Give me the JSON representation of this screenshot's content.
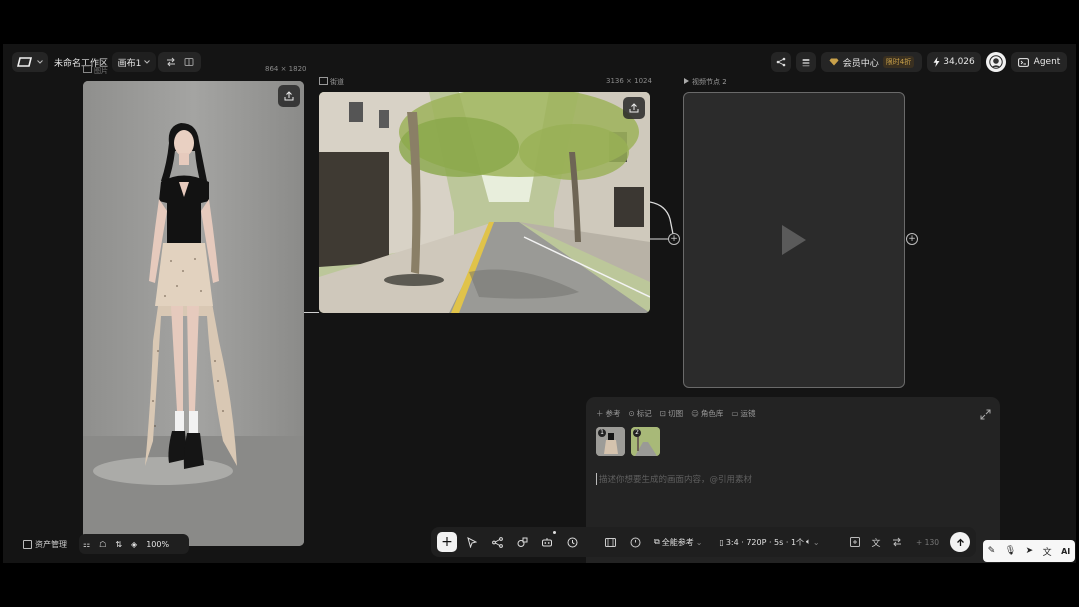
{
  "header": {
    "workspace_name": "未命名工作区",
    "canvas_label": "画布1",
    "member_center_label": "会员中心",
    "member_badge": "限时4折",
    "credits": "34,026",
    "agent_label": "Agent"
  },
  "canvas": {
    "node1": {
      "size_label": "864 × 1820",
      "title": "图片"
    },
    "node2": {
      "title": "街道",
      "size_label": "3136 × 1024"
    },
    "node3": {
      "title": "视频节点 2"
    }
  },
  "bottom_left": {
    "asset_manager_label": "资产管理",
    "zoom": "100%"
  },
  "prompt_panel": {
    "tags": [
      "参考",
      "标记",
      "切图",
      "角色库",
      "运镜"
    ],
    "thumb_badges": [
      "1",
      "2"
    ],
    "placeholder": "描述你想要生成的画面内容，@引用素材",
    "mode_label": "全能参考",
    "settings_label": "3:4 · 720P · 5s · 1个",
    "credit_cost": "+ 130"
  },
  "ime": {
    "ai_label": "AI"
  },
  "icons": {
    "logo": "logo-icon",
    "share": "share-icon",
    "layers": "layers-icon",
    "bolt": "bolt-icon",
    "avatar": "avatar-icon",
    "agent": "agent-icon",
    "upload": "upload-icon",
    "play": "play-icon",
    "expand": "expand-icon"
  },
  "colors": {
    "background": "#141414",
    "panel": "#232323",
    "pill": "#252525",
    "accent_gold": "#c9a14a",
    "video_node": "#2b2b2b"
  }
}
